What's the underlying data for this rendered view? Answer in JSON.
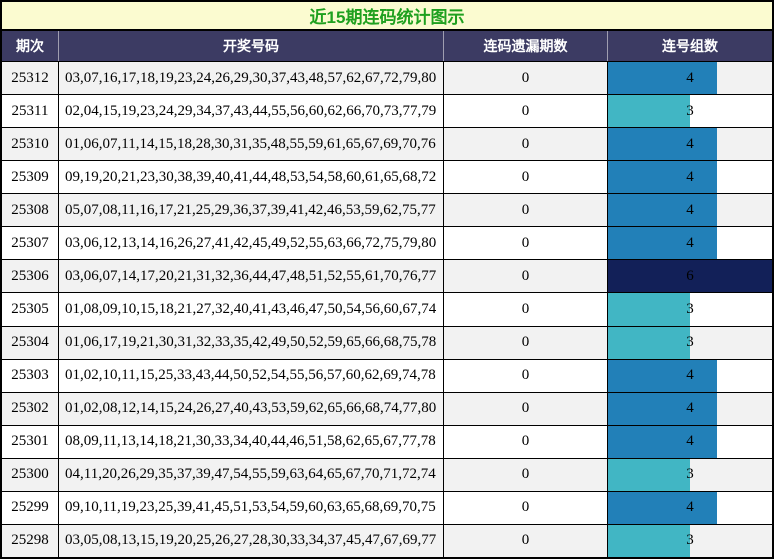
{
  "title": "近15期连码统计图示",
  "header": {
    "period": "期次",
    "numbers": "开奖号码",
    "miss": "连码遗漏期数",
    "groups": "连号组数"
  },
  "bar_max": 6,
  "colors": {
    "title_bg": "#fbfbd0",
    "title_text": "#1fa01f",
    "header_bg": "#3c3b63",
    "header_text": "#ffffff",
    "row_bg": "#ffffff",
    "row_alt_bg": "#f2f2f2",
    "grid_line": "#000000",
    "bar_3": "#41b6c4",
    "bar_4": "#2280b8",
    "bar_6": "#122058"
  },
  "rows": [
    {
      "period": "25312",
      "numbers": "03,07,16,17,18,19,23,24,26,29,30,37,43,48,57,62,67,72,79,80",
      "miss": "0",
      "groups": 4
    },
    {
      "period": "25311",
      "numbers": "02,04,15,19,23,24,29,34,37,43,44,55,56,60,62,66,70,73,77,79",
      "miss": "0",
      "groups": 3
    },
    {
      "period": "25310",
      "numbers": "01,06,07,11,14,15,18,28,30,31,35,48,55,59,61,65,67,69,70,76",
      "miss": "0",
      "groups": 4
    },
    {
      "period": "25309",
      "numbers": "09,19,20,21,23,30,38,39,40,41,44,48,53,54,58,60,61,65,68,72",
      "miss": "0",
      "groups": 4
    },
    {
      "period": "25308",
      "numbers": "05,07,08,11,16,17,21,25,29,36,37,39,41,42,46,53,59,62,75,77",
      "miss": "0",
      "groups": 4
    },
    {
      "period": "25307",
      "numbers": "03,06,12,13,14,16,26,27,41,42,45,49,52,55,63,66,72,75,79,80",
      "miss": "0",
      "groups": 4
    },
    {
      "period": "25306",
      "numbers": "03,06,07,14,17,20,21,31,32,36,44,47,48,51,52,55,61,70,76,77",
      "miss": "0",
      "groups": 6
    },
    {
      "period": "25305",
      "numbers": "01,08,09,10,15,18,21,27,32,40,41,43,46,47,50,54,56,60,67,74",
      "miss": "0",
      "groups": 3
    },
    {
      "period": "25304",
      "numbers": "01,06,17,19,21,30,31,32,33,35,42,49,50,52,59,65,66,68,75,78",
      "miss": "0",
      "groups": 3
    },
    {
      "period": "25303",
      "numbers": "01,02,10,11,15,25,33,43,44,50,52,54,55,56,57,60,62,69,74,78",
      "miss": "0",
      "groups": 4
    },
    {
      "period": "25302",
      "numbers": "01,02,08,12,14,15,24,26,27,40,43,53,59,62,65,66,68,74,77,80",
      "miss": "0",
      "groups": 4
    },
    {
      "period": "25301",
      "numbers": "08,09,11,13,14,18,21,30,33,34,40,44,46,51,58,62,65,67,77,78",
      "miss": "0",
      "groups": 4
    },
    {
      "period": "25300",
      "numbers": "04,11,20,26,29,35,37,39,47,54,55,59,63,64,65,67,70,71,72,74",
      "miss": "0",
      "groups": 3
    },
    {
      "period": "25299",
      "numbers": "09,10,11,19,23,25,39,41,45,51,53,54,59,60,63,65,68,69,70,75",
      "miss": "0",
      "groups": 4
    },
    {
      "period": "25298",
      "numbers": "03,05,08,13,15,19,20,25,26,27,28,30,33,34,37,45,47,67,69,77",
      "miss": "0",
      "groups": 3
    }
  ],
  "chart_data": {
    "type": "bar",
    "orientation": "horizontal",
    "title": "近15期连码统计图示",
    "categories": [
      "25312",
      "25311",
      "25310",
      "25309",
      "25308",
      "25307",
      "25306",
      "25305",
      "25304",
      "25303",
      "25302",
      "25301",
      "25300",
      "25299",
      "25298"
    ],
    "series": [
      {
        "name": "连号组数",
        "values": [
          4,
          3,
          4,
          4,
          4,
          4,
          6,
          3,
          3,
          4,
          4,
          4,
          3,
          4,
          3
        ]
      },
      {
        "name": "连码遗漏期数",
        "values": [
          0,
          0,
          0,
          0,
          0,
          0,
          0,
          0,
          0,
          0,
          0,
          0,
          0,
          0,
          0
        ]
      }
    ],
    "xlabel": "连号组数",
    "ylabel": "期次",
    "xlim": [
      0,
      6
    ],
    "grid": false,
    "legend": "none",
    "value_labels": "shown centered in bar column",
    "bar_color_map": {
      "3": "#41b6c4",
      "4": "#2280b8",
      "6": "#122058"
    }
  }
}
